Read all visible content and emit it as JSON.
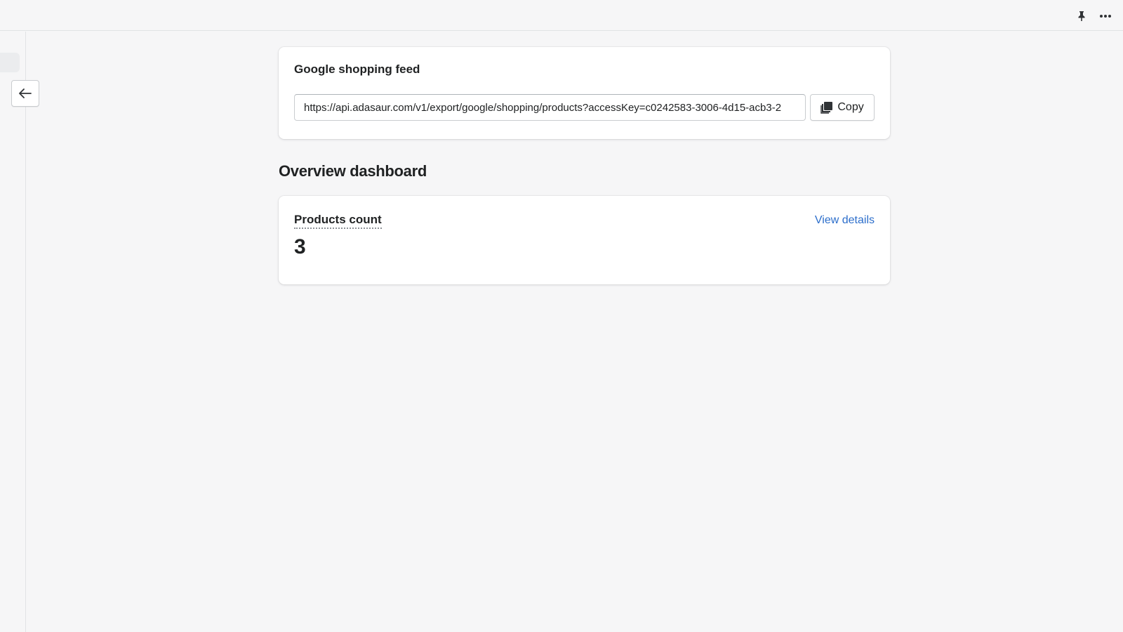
{
  "topbar": {
    "pin_icon": "pin-icon",
    "more_icon": "more-horizontal-icon"
  },
  "navigation": {
    "back_icon": "arrow-left-icon"
  },
  "feed": {
    "title": "Google shopping feed",
    "url": "https://api.adasaur.com/v1/export/google/shopping/products?accessKey=c0242583-3006-4d15-acb3-2",
    "copy_label": "Copy",
    "copy_icon": "copy-icon"
  },
  "dashboard": {
    "heading": "Overview dashboard",
    "products_count_label": "Products count",
    "products_count_value": "3",
    "view_details_label": "View details"
  },
  "colors": {
    "background": "#f6f6f7",
    "card": "#ffffff",
    "link": "#2c6ecb",
    "text": "#202223"
  }
}
